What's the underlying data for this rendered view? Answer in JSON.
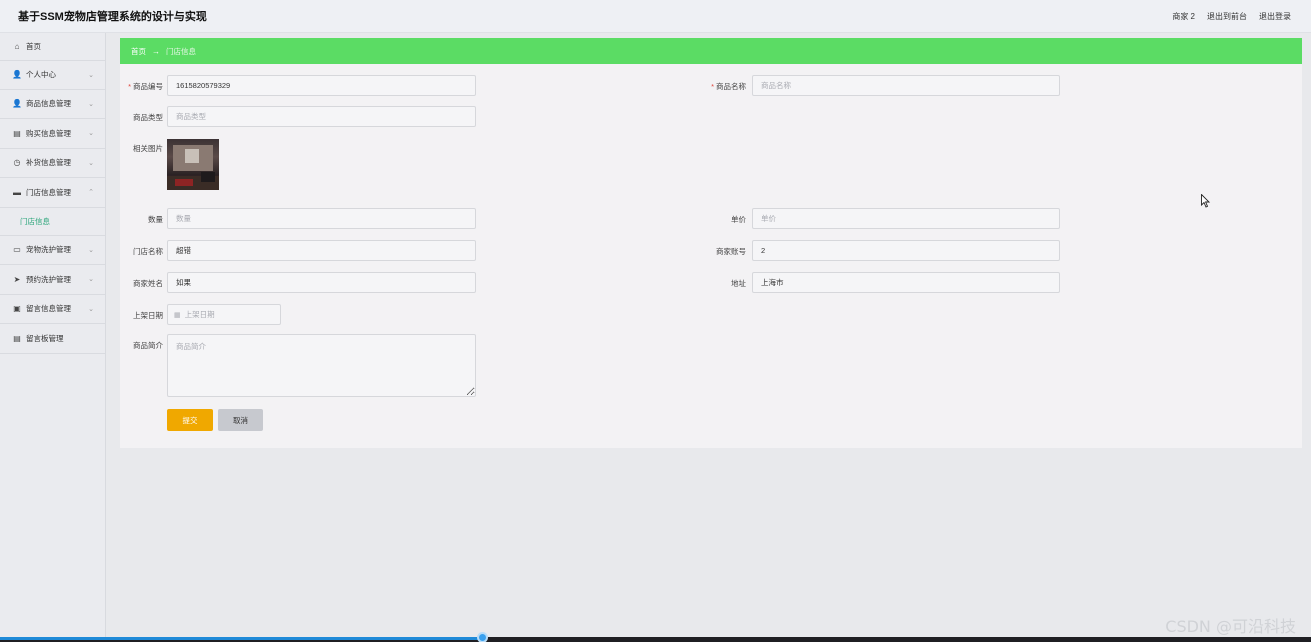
{
  "header": {
    "title": "基于SSM宠物店管理系统的设计与实现",
    "user": "商家 2",
    "back_to_front": "退出到前台",
    "logout": "退出登录"
  },
  "sidebar": {
    "items": [
      {
        "label": "首页",
        "icon": "home-icon"
      },
      {
        "label": "个人中心",
        "icon": "user-icon"
      },
      {
        "label": "商品信息管理",
        "icon": "user-icon"
      },
      {
        "label": "购买信息管理",
        "icon": "clipboard-icon"
      },
      {
        "label": "补货信息管理",
        "icon": "clock-icon"
      },
      {
        "label": "门店信息管理",
        "icon": "message-icon"
      },
      {
        "label": "宠物洗护管理",
        "icon": "card-icon"
      },
      {
        "label": "预约洗护管理",
        "icon": "send-icon"
      },
      {
        "label": "留言信息管理",
        "icon": "cart-icon"
      },
      {
        "label": "留言板管理",
        "icon": "clipboard-icon"
      }
    ],
    "submenu_active": "门店信息"
  },
  "breadcrumb": {
    "home": "首页",
    "separator": "→",
    "current": "门店信息"
  },
  "form": {
    "product_no": {
      "label": "商品编号",
      "value": "1615820579329"
    },
    "product_name": {
      "label": "商品名称",
      "placeholder": "商品名称"
    },
    "product_type": {
      "label": "商品类型",
      "placeholder": "商品类型"
    },
    "image": {
      "label": "相关图片"
    },
    "quantity": {
      "label": "数量",
      "placeholder": "数量"
    },
    "price": {
      "label": "单价",
      "placeholder": "单价"
    },
    "store_name": {
      "label": "门店名称",
      "value": "超错"
    },
    "merchant_account": {
      "label": "商家账号",
      "value": "2"
    },
    "merchant_name": {
      "label": "商家姓名",
      "value": "如果"
    },
    "address": {
      "label": "地址",
      "value": "上海市"
    },
    "listing_date": {
      "label": "上架日期",
      "placeholder": "上架日期"
    },
    "intro": {
      "label": "商品简介",
      "placeholder": "商品简介"
    },
    "submit": "提交",
    "cancel": "取消"
  },
  "watermark": "CSDN @可沿科技",
  "video_progress": 0.368,
  "colors": {
    "breadcrumb_bg": "#5bdc64",
    "submit_bg": "#f0a800",
    "submenu_active": "#2aa57a",
    "required_mark": "#e0473c"
  }
}
